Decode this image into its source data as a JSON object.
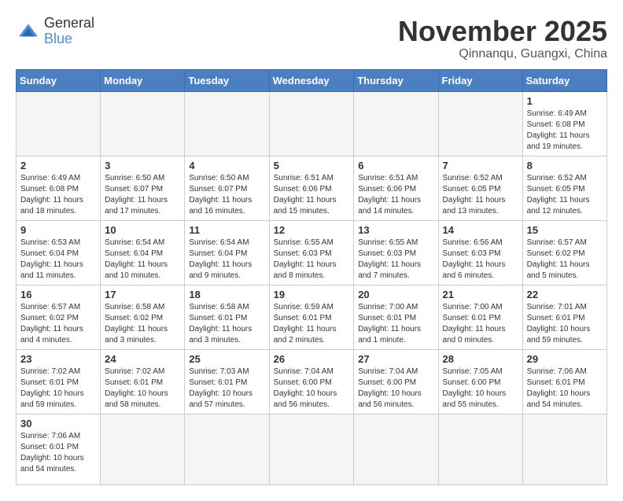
{
  "header": {
    "logo_general": "General",
    "logo_blue": "Blue",
    "month_title": "November 2025",
    "location": "Qinnanqu, Guangxi, China"
  },
  "weekdays": [
    "Sunday",
    "Monday",
    "Tuesday",
    "Wednesday",
    "Thursday",
    "Friday",
    "Saturday"
  ],
  "weeks": [
    [
      {
        "day": "",
        "info": ""
      },
      {
        "day": "",
        "info": ""
      },
      {
        "day": "",
        "info": ""
      },
      {
        "day": "",
        "info": ""
      },
      {
        "day": "",
        "info": ""
      },
      {
        "day": "",
        "info": ""
      },
      {
        "day": "1",
        "info": "Sunrise: 6:49 AM\nSunset: 6:08 PM\nDaylight: 11 hours\nand 19 minutes."
      }
    ],
    [
      {
        "day": "2",
        "info": "Sunrise: 6:49 AM\nSunset: 6:08 PM\nDaylight: 11 hours\nand 18 minutes."
      },
      {
        "day": "3",
        "info": "Sunrise: 6:50 AM\nSunset: 6:07 PM\nDaylight: 11 hours\nand 17 minutes."
      },
      {
        "day": "4",
        "info": "Sunrise: 6:50 AM\nSunset: 6:07 PM\nDaylight: 11 hours\nand 16 minutes."
      },
      {
        "day": "5",
        "info": "Sunrise: 6:51 AM\nSunset: 6:06 PM\nDaylight: 11 hours\nand 15 minutes."
      },
      {
        "day": "6",
        "info": "Sunrise: 6:51 AM\nSunset: 6:06 PM\nDaylight: 11 hours\nand 14 minutes."
      },
      {
        "day": "7",
        "info": "Sunrise: 6:52 AM\nSunset: 6:05 PM\nDaylight: 11 hours\nand 13 minutes."
      },
      {
        "day": "8",
        "info": "Sunrise: 6:52 AM\nSunset: 6:05 PM\nDaylight: 11 hours\nand 12 minutes."
      }
    ],
    [
      {
        "day": "9",
        "info": "Sunrise: 6:53 AM\nSunset: 6:04 PM\nDaylight: 11 hours\nand 11 minutes."
      },
      {
        "day": "10",
        "info": "Sunrise: 6:54 AM\nSunset: 6:04 PM\nDaylight: 11 hours\nand 10 minutes."
      },
      {
        "day": "11",
        "info": "Sunrise: 6:54 AM\nSunset: 6:04 PM\nDaylight: 11 hours\nand 9 minutes."
      },
      {
        "day": "12",
        "info": "Sunrise: 6:55 AM\nSunset: 6:03 PM\nDaylight: 11 hours\nand 8 minutes."
      },
      {
        "day": "13",
        "info": "Sunrise: 6:55 AM\nSunset: 6:03 PM\nDaylight: 11 hours\nand 7 minutes."
      },
      {
        "day": "14",
        "info": "Sunrise: 6:56 AM\nSunset: 6:03 PM\nDaylight: 11 hours\nand 6 minutes."
      },
      {
        "day": "15",
        "info": "Sunrise: 6:57 AM\nSunset: 6:02 PM\nDaylight: 11 hours\nand 5 minutes."
      }
    ],
    [
      {
        "day": "16",
        "info": "Sunrise: 6:57 AM\nSunset: 6:02 PM\nDaylight: 11 hours\nand 4 minutes."
      },
      {
        "day": "17",
        "info": "Sunrise: 6:58 AM\nSunset: 6:02 PM\nDaylight: 11 hours\nand 3 minutes."
      },
      {
        "day": "18",
        "info": "Sunrise: 6:58 AM\nSunset: 6:01 PM\nDaylight: 11 hours\nand 3 minutes."
      },
      {
        "day": "19",
        "info": "Sunrise: 6:59 AM\nSunset: 6:01 PM\nDaylight: 11 hours\nand 2 minutes."
      },
      {
        "day": "20",
        "info": "Sunrise: 7:00 AM\nSunset: 6:01 PM\nDaylight: 11 hours\nand 1 minute."
      },
      {
        "day": "21",
        "info": "Sunrise: 7:00 AM\nSunset: 6:01 PM\nDaylight: 11 hours\nand 0 minutes."
      },
      {
        "day": "22",
        "info": "Sunrise: 7:01 AM\nSunset: 6:01 PM\nDaylight: 10 hours\nand 59 minutes."
      }
    ],
    [
      {
        "day": "23",
        "info": "Sunrise: 7:02 AM\nSunset: 6:01 PM\nDaylight: 10 hours\nand 59 minutes."
      },
      {
        "day": "24",
        "info": "Sunrise: 7:02 AM\nSunset: 6:01 PM\nDaylight: 10 hours\nand 58 minutes."
      },
      {
        "day": "25",
        "info": "Sunrise: 7:03 AM\nSunset: 6:01 PM\nDaylight: 10 hours\nand 57 minutes."
      },
      {
        "day": "26",
        "info": "Sunrise: 7:04 AM\nSunset: 6:00 PM\nDaylight: 10 hours\nand 56 minutes."
      },
      {
        "day": "27",
        "info": "Sunrise: 7:04 AM\nSunset: 6:00 PM\nDaylight: 10 hours\nand 56 minutes."
      },
      {
        "day": "28",
        "info": "Sunrise: 7:05 AM\nSunset: 6:00 PM\nDaylight: 10 hours\nand 55 minutes."
      },
      {
        "day": "29",
        "info": "Sunrise: 7:06 AM\nSunset: 6:01 PM\nDaylight: 10 hours\nand 54 minutes."
      }
    ],
    [
      {
        "day": "30",
        "info": "Sunrise: 7:06 AM\nSunset: 6:01 PM\nDaylight: 10 hours\nand 54 minutes."
      },
      {
        "day": "",
        "info": ""
      },
      {
        "day": "",
        "info": ""
      },
      {
        "day": "",
        "info": ""
      },
      {
        "day": "",
        "info": ""
      },
      {
        "day": "",
        "info": ""
      },
      {
        "day": "",
        "info": ""
      }
    ]
  ]
}
